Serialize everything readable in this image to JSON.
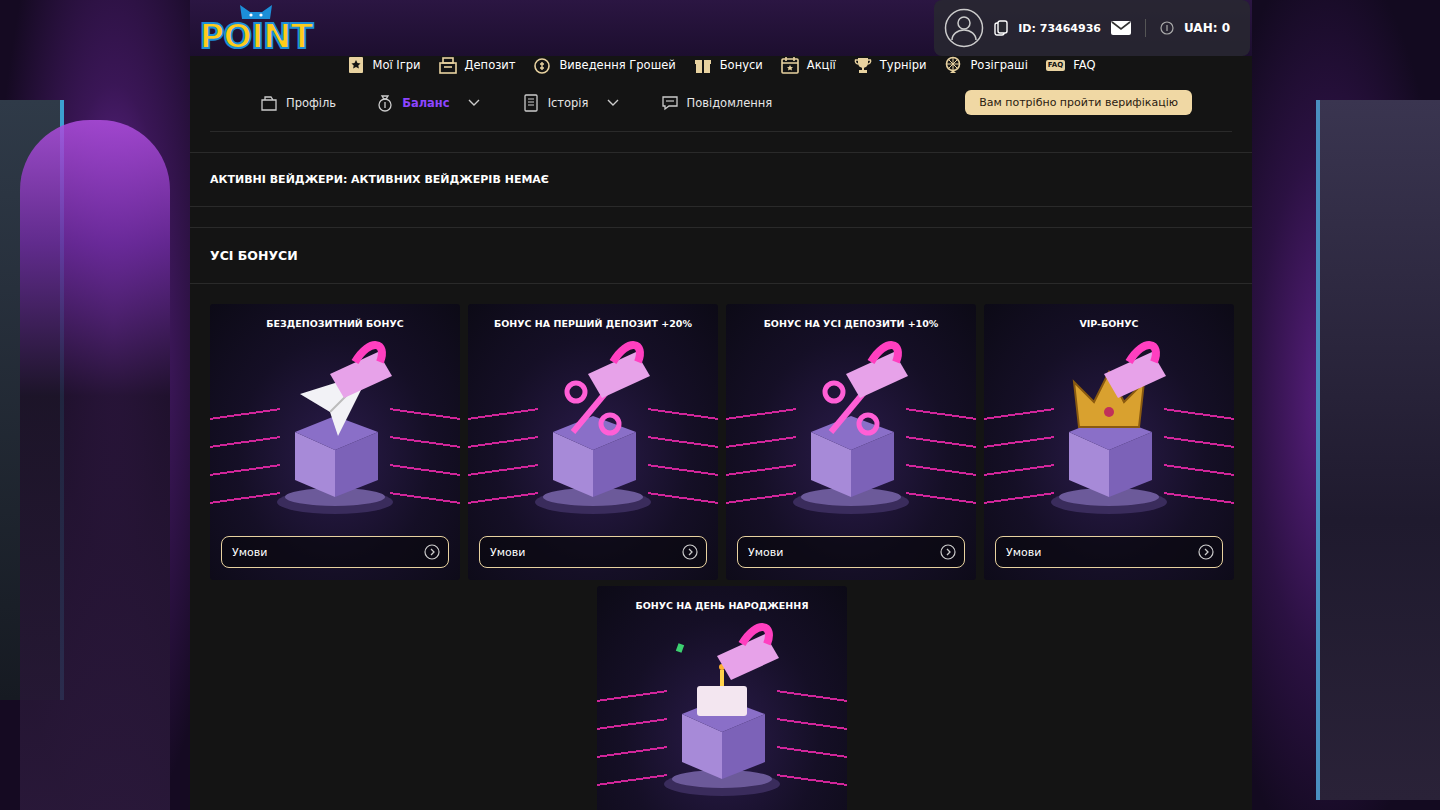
{
  "logo": "POINT",
  "user": {
    "id": "ID: 73464936",
    "balance": "UAH: 0"
  },
  "nav": [
    {
      "label": "Мої Ігри"
    },
    {
      "label": "Депозит"
    },
    {
      "label": "Виведення Грошей"
    },
    {
      "label": "Бонуси"
    },
    {
      "label": "Акції"
    },
    {
      "label": "Турніри"
    },
    {
      "label": "Розіграші"
    },
    {
      "label": "FAQ",
      "badge": "FAQ"
    }
  ],
  "subnav": [
    {
      "label": "Профіль",
      "selected": false,
      "dropdown": false
    },
    {
      "label": "Баланс",
      "selected": true,
      "dropdown": true
    },
    {
      "label": "Історія",
      "selected": false,
      "dropdown": true
    },
    {
      "label": "Повідомлення",
      "selected": false,
      "dropdown": false
    }
  ],
  "verify_button": "Вам потрібно пройти верифікацію",
  "wagers": "АКТИВНІ ВЕЙДЖЕРИ: АКТИВНИХ ВЕЙДЖЕРІВ НЕМАЄ",
  "bonuses_title": "УСІ БОНУСИ",
  "bonuses": [
    {
      "title": "БЕЗДЕПОЗИТНИЙ БОНУС",
      "kind": "plane",
      "button": "Умови"
    },
    {
      "title": "БОНУС НА ПЕРШИЙ ДЕПОЗИТ +20%",
      "kind": "percent",
      "button": "Умови"
    },
    {
      "title": "БОНУС НА УСІ ДЕПОЗИТИ +10%",
      "kind": "percent",
      "button": "Умови"
    },
    {
      "title": "VIP-БОНУС",
      "kind": "crown",
      "button": "Умови"
    },
    {
      "title": "БОНУС НА ДЕНЬ НАРОДЖЕННЯ",
      "kind": "cake"
    }
  ]
}
